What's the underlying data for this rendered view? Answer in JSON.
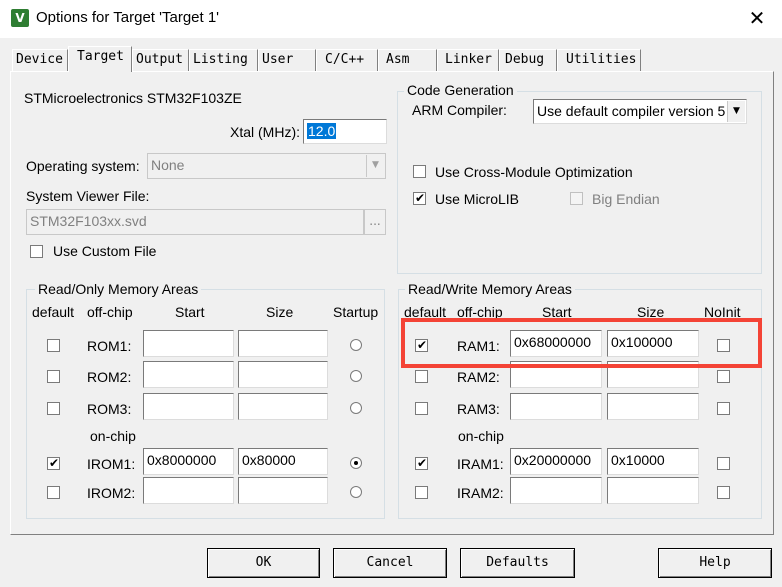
{
  "window": {
    "title": "Options for Target 'Target 1'",
    "app_icon_glyph": "V",
    "close_glyph": "✕"
  },
  "tabs": [
    {
      "label": "Device",
      "active": false
    },
    {
      "label": "Target",
      "active": true
    },
    {
      "label": "Output",
      "active": false
    },
    {
      "label": "Listing",
      "active": false
    },
    {
      "label": "User",
      "active": false
    },
    {
      "label": "C/C++",
      "active": false
    },
    {
      "label": "Asm",
      "active": false
    },
    {
      "label": "Linker",
      "active": false
    },
    {
      "label": "Debug",
      "active": false
    },
    {
      "label": "Utilities",
      "active": false
    }
  ],
  "device_name": "STMicroelectronics STM32F103ZE",
  "xtal": {
    "label": "Xtal (MHz):",
    "value": "12.0"
  },
  "os": {
    "label": "Operating system:",
    "value": "None"
  },
  "sysviewer": {
    "label": "System Viewer File:",
    "value": "STM32F103xx.svd",
    "browse": "..."
  },
  "custom_file": {
    "label": "Use Custom File",
    "checked": false
  },
  "codegen": {
    "group_label": "Code Generation",
    "compiler_label": "ARM Compiler:",
    "compiler_value": "Use default compiler version 5",
    "cross_module": {
      "label": "Use Cross-Module Optimization",
      "checked": false
    },
    "microlib": {
      "label": "Use MicroLIB",
      "checked": true
    },
    "big_endian": {
      "label": "Big Endian",
      "checked": false,
      "disabled": true
    }
  },
  "rom": {
    "group_label": "Read/Only Memory Areas",
    "headers": {
      "default": "default",
      "offchip": "off-chip",
      "start": "Start",
      "size": "Size",
      "startup": "Startup"
    },
    "onchip_label": "on-chip",
    "rows": [
      {
        "name": "ROM1:",
        "default": false,
        "start": "",
        "size": "",
        "startup": false
      },
      {
        "name": "ROM2:",
        "default": false,
        "start": "",
        "size": "",
        "startup": false
      },
      {
        "name": "ROM3:",
        "default": false,
        "start": "",
        "size": "",
        "startup": false
      },
      {
        "name": "IROM1:",
        "default": true,
        "start": "0x8000000",
        "size": "0x80000",
        "startup": true
      },
      {
        "name": "IROM2:",
        "default": false,
        "start": "",
        "size": "",
        "startup": false
      }
    ]
  },
  "ram": {
    "group_label": "Read/Write Memory Areas",
    "headers": {
      "default": "default",
      "offchip": "off-chip",
      "start": "Start",
      "size": "Size",
      "noinit": "NoInit"
    },
    "onchip_label": "on-chip",
    "rows": [
      {
        "name": "RAM1:",
        "default": true,
        "start": "0x68000000",
        "size": "0x100000",
        "noinit": false
      },
      {
        "name": "RAM2:",
        "default": false,
        "start": "",
        "size": "",
        "noinit": false
      },
      {
        "name": "RAM3:",
        "default": false,
        "start": "",
        "size": "",
        "noinit": false
      },
      {
        "name": "IRAM1:",
        "default": true,
        "start": "0x20000000",
        "size": "0x10000",
        "noinit": false
      },
      {
        "name": "IRAM2:",
        "default": false,
        "start": "",
        "size": "",
        "noinit": false
      }
    ]
  },
  "buttons": {
    "ok": "OK",
    "cancel": "Cancel",
    "defaults": "Defaults",
    "help": "Help"
  },
  "annotation": {
    "highlight_color": "#f44336"
  }
}
